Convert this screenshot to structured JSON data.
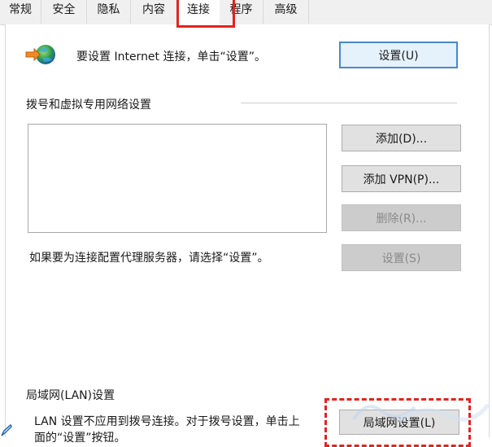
{
  "tabs": [
    {
      "label": "常规"
    },
    {
      "label": "安全"
    },
    {
      "label": "隐私"
    },
    {
      "label": "内容"
    },
    {
      "label": "连接",
      "active": true
    },
    {
      "label": "程序"
    },
    {
      "label": "高级"
    }
  ],
  "setup": {
    "text": "要设置 Internet 连接，单击“设置”。",
    "button": "设置(U)"
  },
  "dialup": {
    "group_title": "拨号和虚拟专用网络设置",
    "add_button": "添加(D)...",
    "add_vpn_button": "添加 VPN(P)...",
    "remove_button": "删除(R)...",
    "proxy_text": "如果要为连接配置代理服务器，请选择“设置”。",
    "settings_button": "设置(S)"
  },
  "lan": {
    "group_title": "局域网(LAN)设置",
    "text_line1": "LAN 设置不应用到拨号连接。对于拨号设置，单击上",
    "text_line2": "面的“设置”按钮。",
    "button": "局域网设置(L)"
  },
  "colors": {
    "highlight": "#e2241c",
    "primary_border": "#4a89c9"
  },
  "icons": {
    "connection": "globe-with-arrow-icon"
  }
}
